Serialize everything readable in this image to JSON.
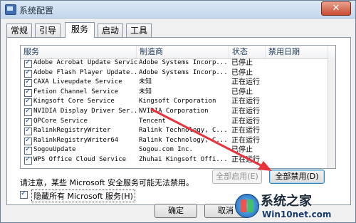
{
  "window": {
    "title": "系统配置",
    "close_glyph": "✕"
  },
  "tabs": [
    {
      "label": "常规"
    },
    {
      "label": "引导"
    },
    {
      "label": "服务",
      "active": true
    },
    {
      "label": "启动"
    },
    {
      "label": "工具"
    }
  ],
  "services_table": {
    "columns": [
      "服务",
      "制造商",
      "状态",
      "禁用日期"
    ],
    "rows": [
      {
        "service": "Adobe Acrobat Update Service",
        "vendor": "Adobe Systems Incorp...",
        "status": "已停止",
        "checked": true
      },
      {
        "service": "Adobe Flash Player Update...",
        "vendor": "Adobe Systems Incorp...",
        "status": "已停止",
        "checked": true
      },
      {
        "service": "CAXA Liveupdate Service",
        "vendor": "未知",
        "status": "正在运行",
        "checked": true
      },
      {
        "service": "Fetion Channel Service",
        "vendor": "未知",
        "status": "已停止",
        "checked": true
      },
      {
        "service": "Kingsoft Core Service",
        "vendor": "Kingsoft Corporation",
        "status": "正在运行",
        "checked": true
      },
      {
        "service": "NVIDIA Display Driver Ser...",
        "vendor": "NVIDIA Corporation",
        "status": "正在运行",
        "checked": true
      },
      {
        "service": "QPCore Service",
        "vendor": "Tencent",
        "status": "正在运行",
        "checked": true
      },
      {
        "service": "RalinkRegistryWriter",
        "vendor": "Ralink Technology, C...",
        "status": "正在运行",
        "checked": true
      },
      {
        "service": "RalinkRegistryWriter64",
        "vendor": "Ralink Technology, C...",
        "status": "正在运行",
        "checked": true
      },
      {
        "service": "SogouUpdate",
        "vendor": "Sogou.com Inc.",
        "status": "已停止",
        "checked": true
      },
      {
        "service": "WPS Office Cloud Service",
        "vendor": "Zhuhai Kingsoft Offi...",
        "status": "正在运行",
        "checked": true
      }
    ]
  },
  "notice": "请注意，某些 Microsoft 安全服务可能无法禁用。",
  "buttons": {
    "enable_all": "全部启用(E)",
    "disable_all": "全部禁用(D)",
    "ok": "确定",
    "cancel": "取消"
  },
  "hide_ms": {
    "label": "隐藏所有 Microsoft 服务(H)",
    "checked": true
  },
  "watermark": {
    "title": "系统之家",
    "subtitle": "Win10net.com"
  },
  "colors": {
    "annotation_arrow": "#e8323c"
  }
}
